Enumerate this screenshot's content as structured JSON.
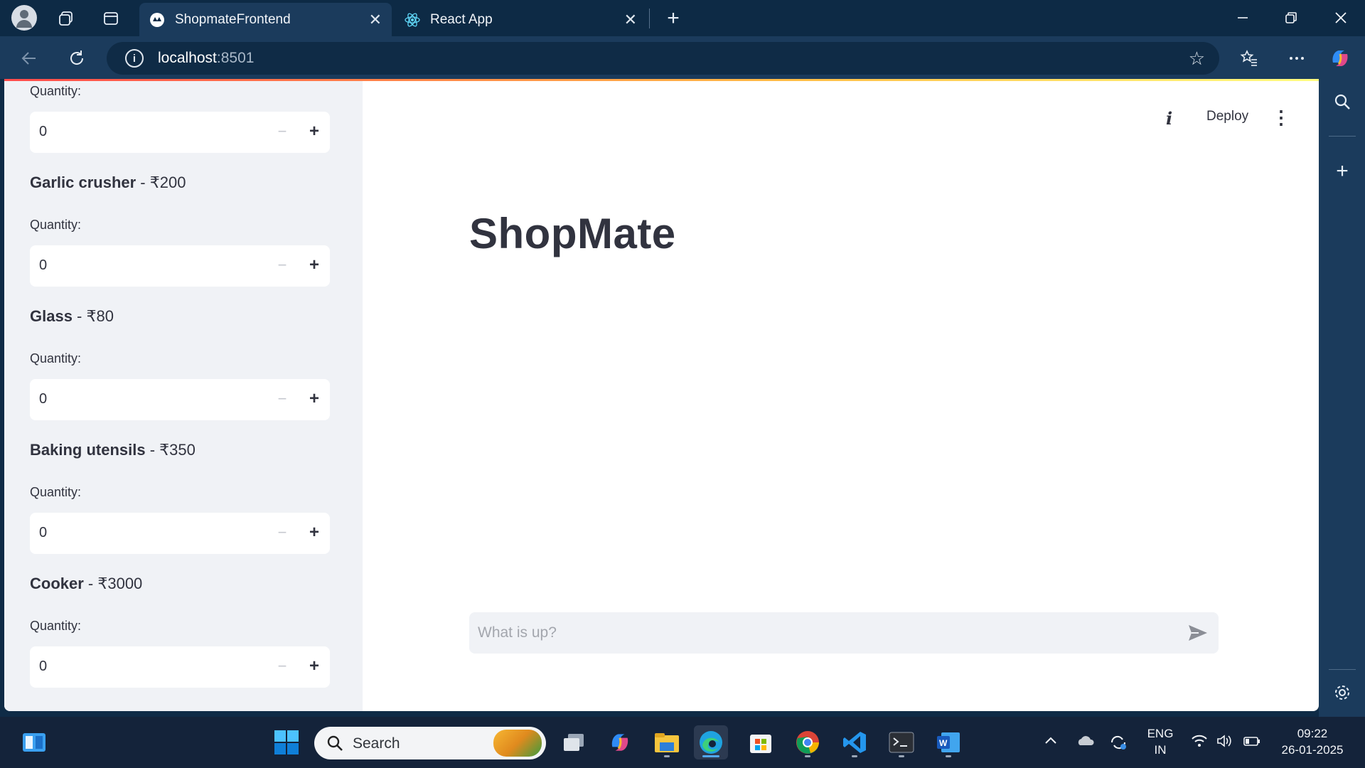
{
  "browser": {
    "tabs": [
      {
        "title": "ShopmateFrontend",
        "active": true
      },
      {
        "title": "React App",
        "active": false
      }
    ],
    "url_host": "localhost",
    "url_port": ":8501"
  },
  "sidebar": {
    "top_quantity_label": "Quantity:",
    "top_quantity_value": "0",
    "products": [
      {
        "name": "Garlic crusher",
        "price": " - ₹200",
        "quantity_label": "Quantity:",
        "quantity": "0"
      },
      {
        "name": "Glass",
        "price": " - ₹80",
        "quantity_label": "Quantity:",
        "quantity": "0"
      },
      {
        "name": "Baking utensils",
        "price": " - ₹350",
        "quantity_label": "Quantity:",
        "quantity": "0"
      },
      {
        "name": "Cooker",
        "price": " - ₹3000",
        "quantity_label": "Quantity:",
        "quantity": "0"
      }
    ],
    "minus_symbol": "−",
    "plus_symbol": "+"
  },
  "header": {
    "deploy_label": "Deploy"
  },
  "main": {
    "title": "ShopMate",
    "chat_placeholder": "What is up?"
  },
  "taskbar": {
    "search_label": "Search",
    "lang_line1": "ENG",
    "lang_line2": "IN",
    "time": "09:22",
    "date": "26-01-2025"
  },
  "colors": {
    "accent": "#ff4b4b",
    "sidebar_bg": "#f0f2f6",
    "text": "#31333f"
  }
}
